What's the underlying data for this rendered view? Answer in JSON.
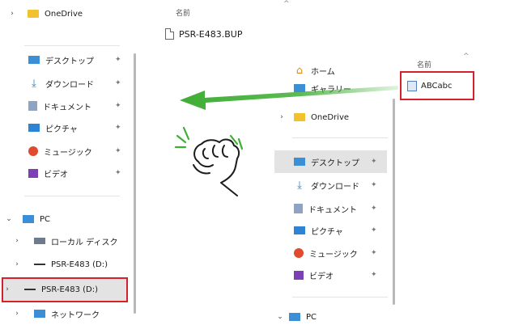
{
  "left_panel": {
    "nav_top": {
      "label": "OneDrive"
    },
    "column_header": "名前",
    "file": {
      "name": "PSR-E483.BUP"
    },
    "quick_access": [
      {
        "label": "デスクトップ",
        "icon": "desktop-icon"
      },
      {
        "label": "ダウンロード",
        "icon": "download-icon"
      },
      {
        "label": "ドキュメント",
        "icon": "documents-icon"
      },
      {
        "label": "ピクチャ",
        "icon": "pictures-icon"
      },
      {
        "label": "ミュージック",
        "icon": "music-icon"
      },
      {
        "label": "ビデオ",
        "icon": "videos-icon"
      }
    ],
    "pc": {
      "label": "PC"
    },
    "drives": [
      {
        "label": "ローカル ディスク"
      },
      {
        "label": "PSR-E483 (D:)"
      },
      {
        "label": "PSR-E483 (D:)",
        "highlighted": true
      },
      {
        "label": "ネットワーク"
      }
    ]
  },
  "right_panel": {
    "home": {
      "label": "ホーム"
    },
    "gallery": {
      "label": "ギャラリー"
    },
    "onedrive": {
      "label": "OneDrive"
    },
    "column_header": "名前",
    "file": {
      "name": "ABCabc"
    },
    "quick_access": [
      {
        "label": "デスクトップ",
        "icon": "desktop-icon"
      },
      {
        "label": "ダウンロード",
        "icon": "download-icon"
      },
      {
        "label": "ドキュメント",
        "icon": "documents-icon"
      },
      {
        "label": "ピクチャ",
        "icon": "pictures-icon"
      },
      {
        "label": "ミュージック",
        "icon": "music-icon"
      },
      {
        "label": "ビデオ",
        "icon": "videos-icon"
      }
    ],
    "pc": {
      "label": "PC"
    }
  },
  "colors": {
    "highlight_red": "#d8202c",
    "arrow_green": "#3fae35",
    "selection_gray": "#e3e3e3",
    "folder_yellow": "#f2c12e"
  }
}
